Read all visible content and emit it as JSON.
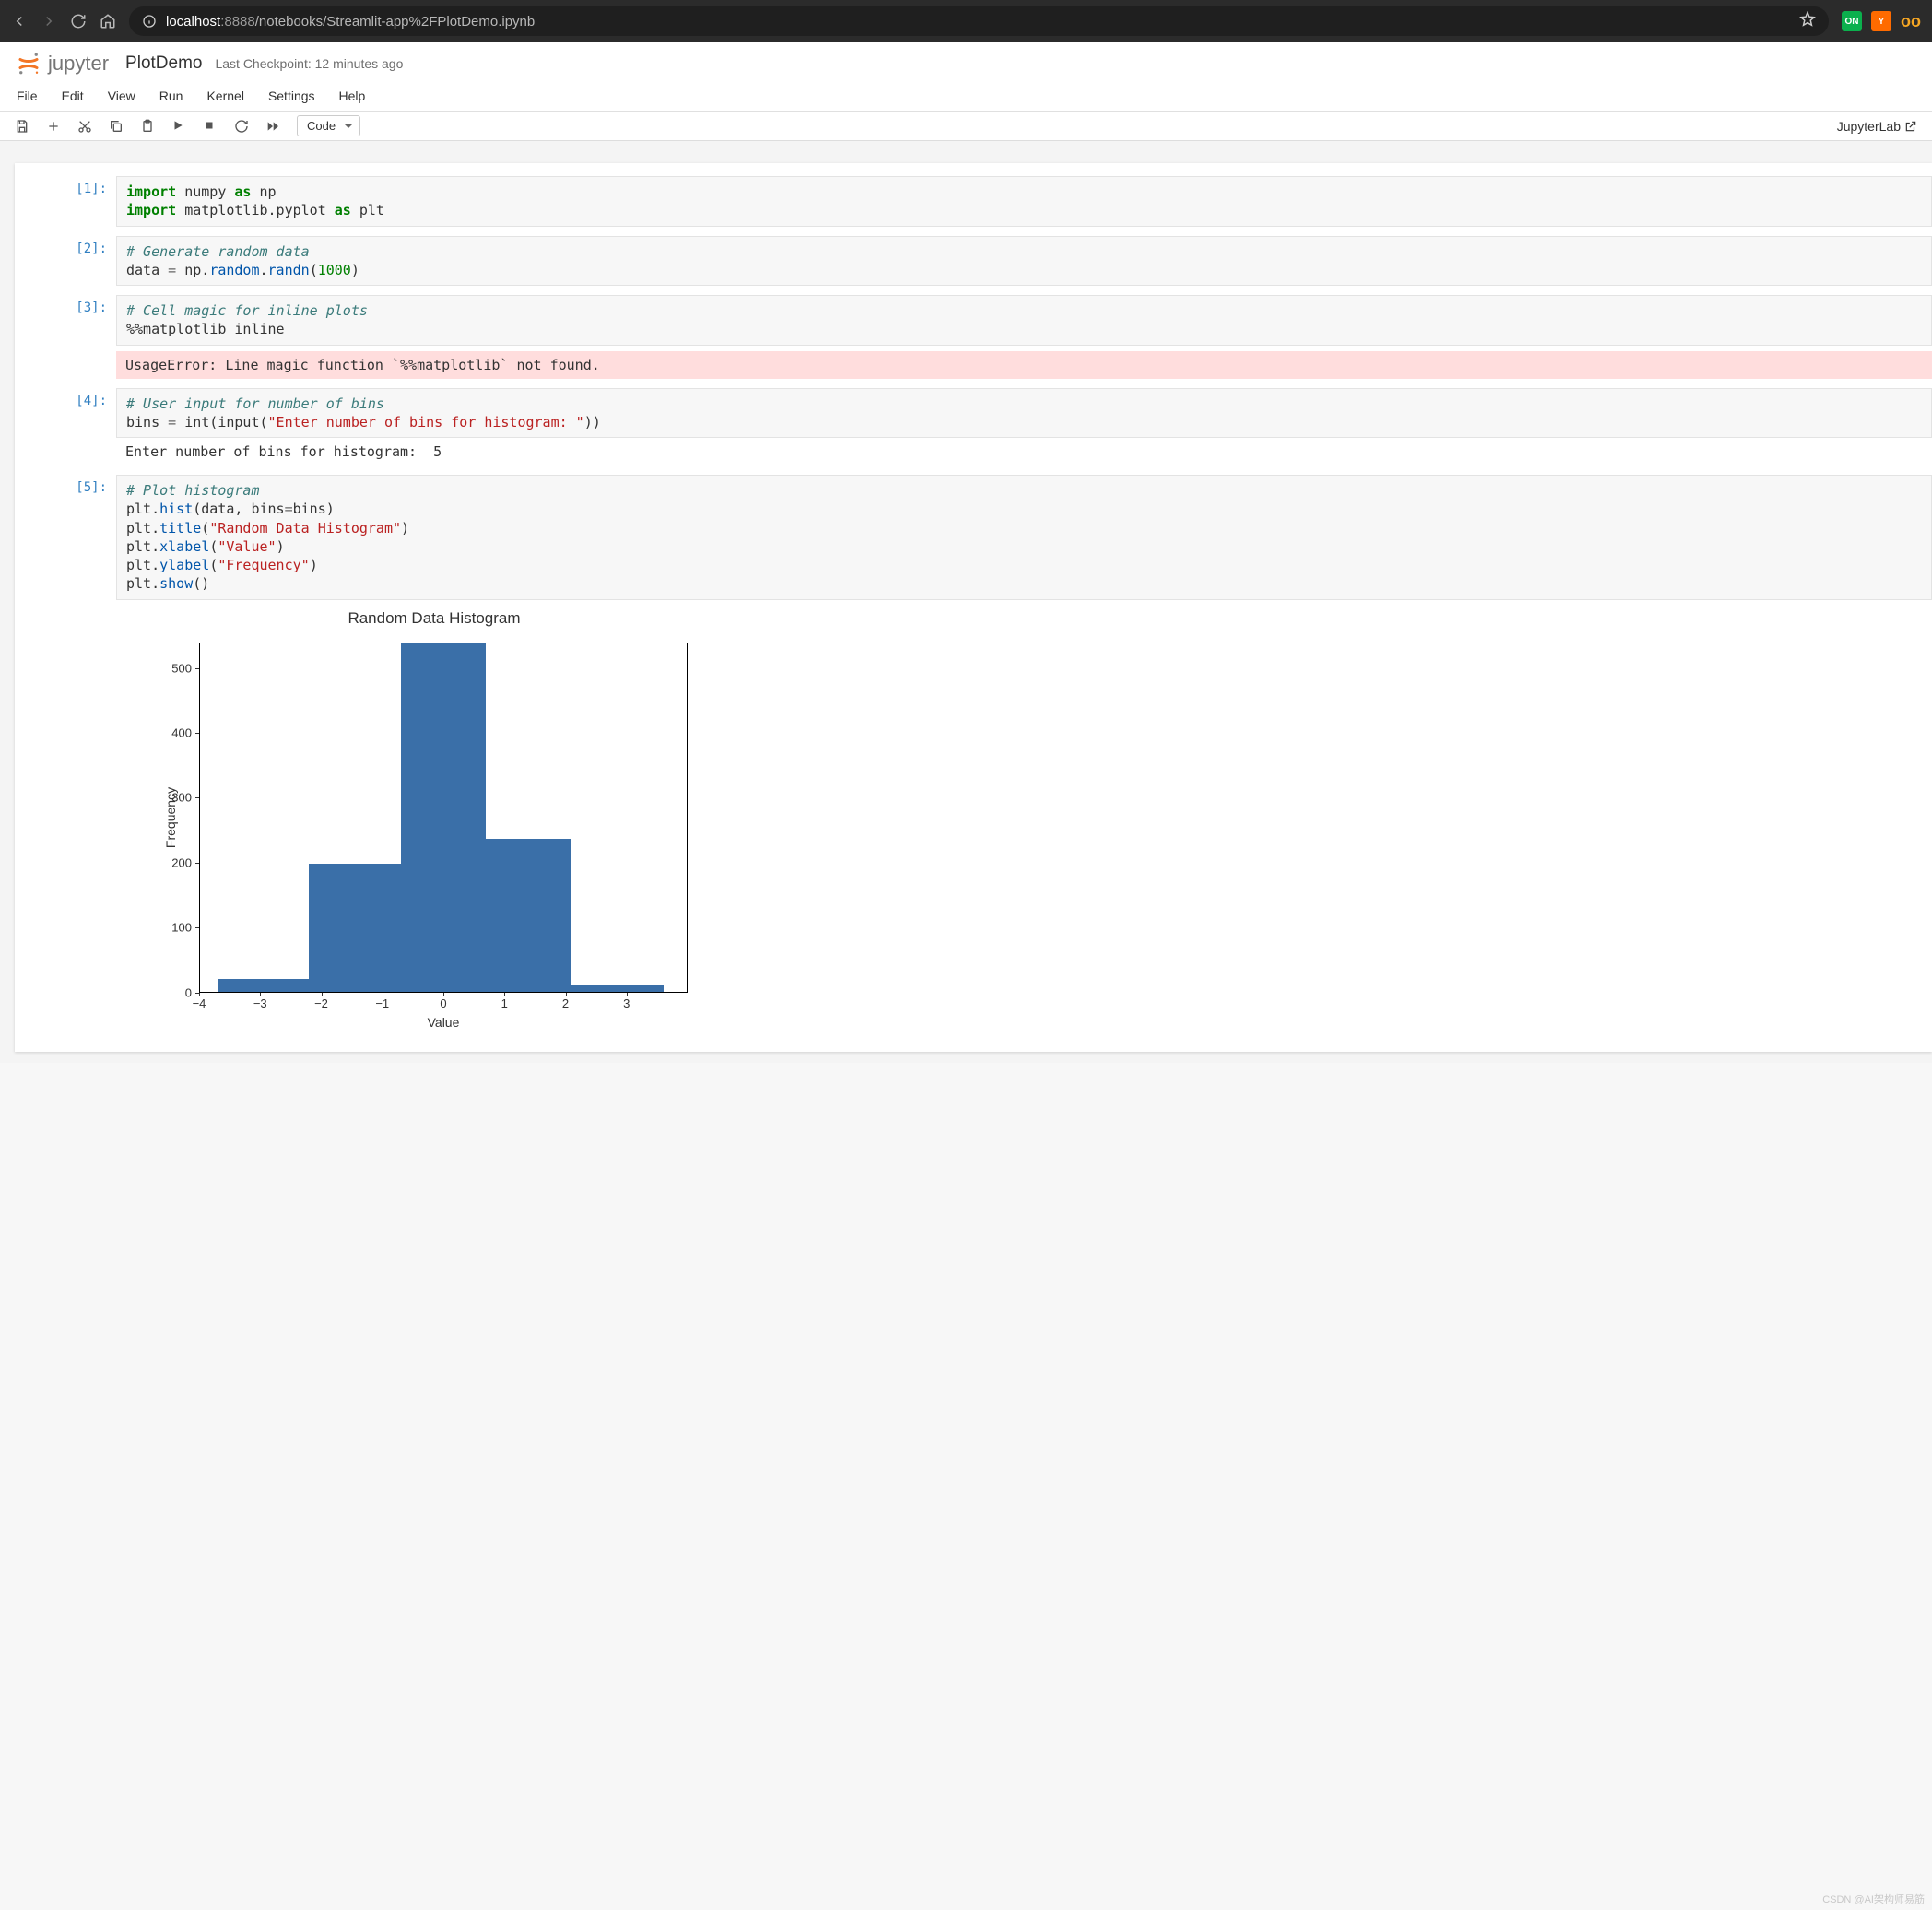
{
  "browser": {
    "url_host1": "localhost",
    "url_host2": ":8888",
    "url_path": "/notebooks/Streamlit-app%2FPlotDemo.ipynb",
    "ext_on": "ON",
    "ext_y": "Y",
    "ext_coo": "oo"
  },
  "header": {
    "logo_text": "jupyter",
    "notebook_title": "PlotDemo",
    "checkpoint": "Last Checkpoint: 12 minutes ago"
  },
  "menu": [
    "File",
    "Edit",
    "View",
    "Run",
    "Kernel",
    "Settings",
    "Help"
  ],
  "toolbar": {
    "cell_type": "Code",
    "jupyterlab": "JupyterLab"
  },
  "cells": {
    "c1": {
      "prompt": "[1]:",
      "tokens": [
        {
          "t": "import",
          "c": "kw"
        },
        {
          "t": " numpy ",
          "c": "nm"
        },
        {
          "t": "as",
          "c": "as"
        },
        {
          "t": " np\n",
          "c": "nm"
        },
        {
          "t": "import",
          "c": "kw"
        },
        {
          "t": " matplotlib.pyplot ",
          "c": "nm"
        },
        {
          "t": "as",
          "c": "as"
        },
        {
          "t": " plt",
          "c": "nm"
        }
      ]
    },
    "c2": {
      "prompt": "[2]:",
      "tokens": [
        {
          "t": "# Generate random data\n",
          "c": "cm"
        },
        {
          "t": "data ",
          "c": "nm"
        },
        {
          "t": "=",
          "c": "op"
        },
        {
          "t": " np.",
          "c": "nm"
        },
        {
          "t": "random",
          "c": "fn"
        },
        {
          "t": ".",
          "c": "nm"
        },
        {
          "t": "randn",
          "c": "fn"
        },
        {
          "t": "(",
          "c": "nm"
        },
        {
          "t": "1000",
          "c": "num"
        },
        {
          "t": ")",
          "c": "nm"
        }
      ]
    },
    "c3": {
      "prompt": "[3]:",
      "tokens": [
        {
          "t": "# Cell magic for inline plots\n",
          "c": "cm"
        },
        {
          "t": "%%matplotlib inline",
          "c": "nm"
        }
      ],
      "error": "UsageError: Line magic function `%%matplotlib` not found."
    },
    "c4": {
      "prompt": "[4]:",
      "tokens": [
        {
          "t": "# User input for number of bins\n",
          "c": "cm"
        },
        {
          "t": "bins ",
          "c": "nm"
        },
        {
          "t": "=",
          "c": "op"
        },
        {
          "t": " int(input(",
          "c": "nm"
        },
        {
          "t": "\"Enter number of bins for histogram: \"",
          "c": "str"
        },
        {
          "t": "))",
          "c": "nm"
        }
      ],
      "stream": "Enter number of bins for histogram:  5"
    },
    "c5": {
      "prompt": "[5]:",
      "tokens": [
        {
          "t": "# Plot histogram\n",
          "c": "cm"
        },
        {
          "t": "plt.",
          "c": "nm"
        },
        {
          "t": "hist",
          "c": "fn"
        },
        {
          "t": "(data, bins",
          "c": "nm"
        },
        {
          "t": "=",
          "c": "op"
        },
        {
          "t": "bins)\n",
          "c": "nm"
        },
        {
          "t": "plt.",
          "c": "nm"
        },
        {
          "t": "title",
          "c": "fn"
        },
        {
          "t": "(",
          "c": "nm"
        },
        {
          "t": "\"Random Data Histogram\"",
          "c": "str"
        },
        {
          "t": ")\n",
          "c": "nm"
        },
        {
          "t": "plt.",
          "c": "nm"
        },
        {
          "t": "xlabel",
          "c": "fn"
        },
        {
          "t": "(",
          "c": "nm"
        },
        {
          "t": "\"Value\"",
          "c": "str"
        },
        {
          "t": ")\n",
          "c": "nm"
        },
        {
          "t": "plt.",
          "c": "nm"
        },
        {
          "t": "ylabel",
          "c": "fn"
        },
        {
          "t": "(",
          "c": "nm"
        },
        {
          "t": "\"Frequency\"",
          "c": "str"
        },
        {
          "t": ")\n",
          "c": "nm"
        },
        {
          "t": "plt.",
          "c": "nm"
        },
        {
          "t": "show",
          "c": "fn"
        },
        {
          "t": "()",
          "c": "nm"
        }
      ]
    }
  },
  "chart_data": {
    "type": "bar",
    "title": "Random Data Histogram",
    "xlabel": "Value",
    "ylabel": "Frequency",
    "xlim": [
      -4,
      4
    ],
    "ylim": [
      0,
      540
    ],
    "xticks": [
      -4,
      -3,
      -2,
      -1,
      0,
      1,
      2,
      3
    ],
    "yticks": [
      0,
      100,
      200,
      300,
      400,
      500
    ],
    "bins": [
      {
        "x0": -3.7,
        "x1": -2.2,
        "count": 20
      },
      {
        "x0": -2.2,
        "x1": -0.7,
        "count": 198
      },
      {
        "x0": -0.7,
        "x1": 0.7,
        "count": 538
      },
      {
        "x0": 0.7,
        "x1": 2.1,
        "count": 236
      },
      {
        "x0": 2.1,
        "x1": 3.6,
        "count": 10
      }
    ]
  },
  "watermark": "CSDN @AI架构师易筋"
}
